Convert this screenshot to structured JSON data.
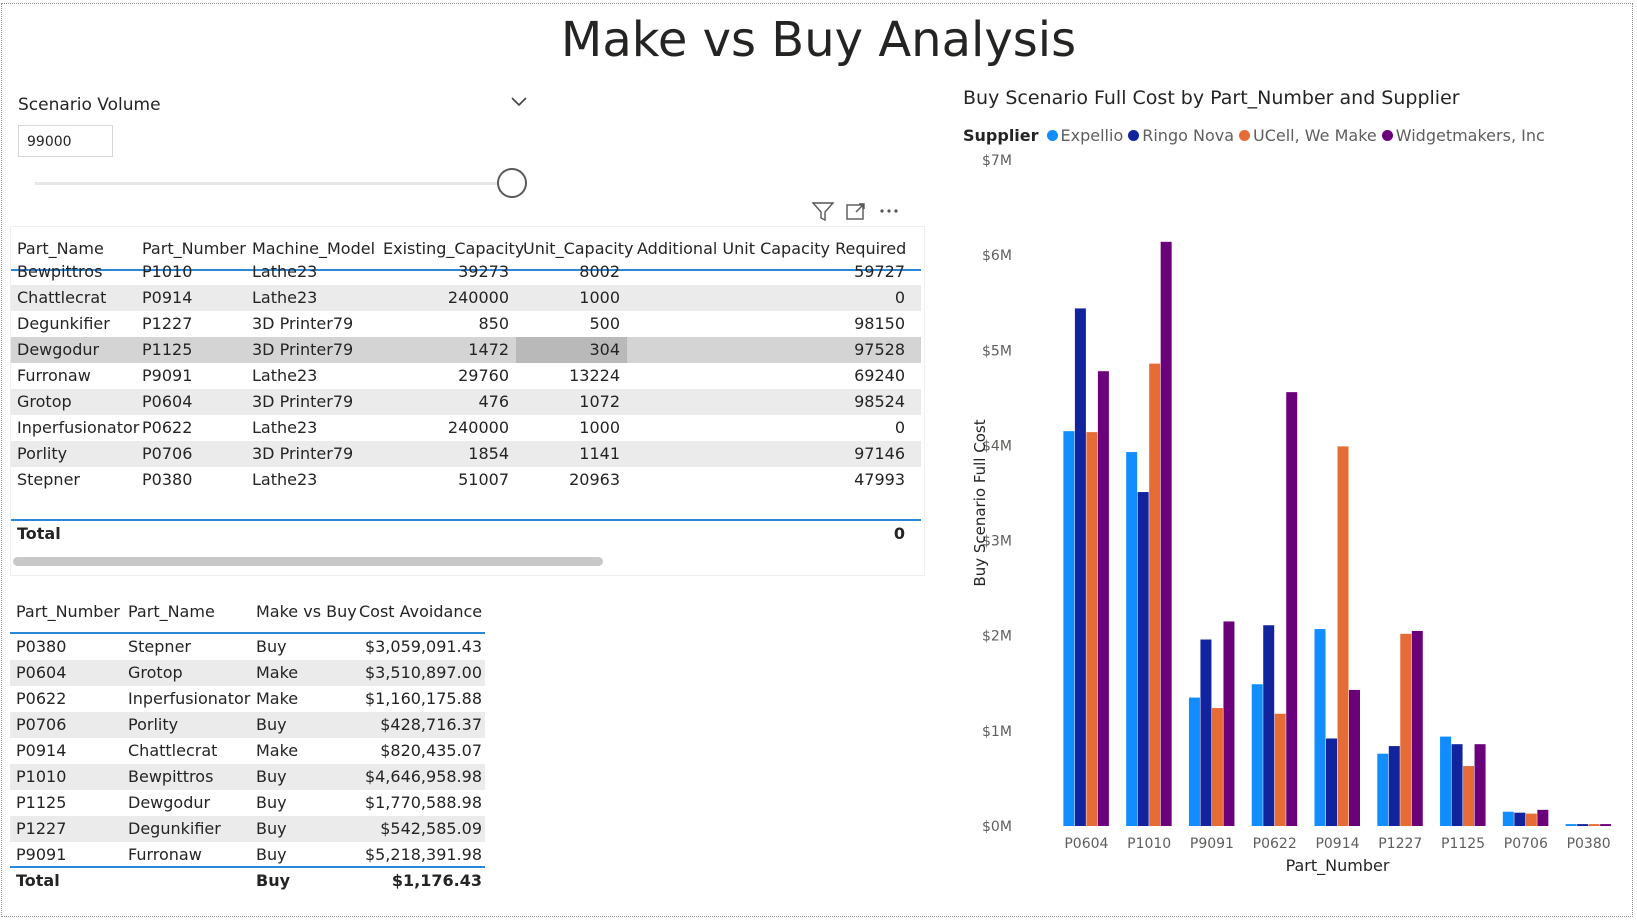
{
  "page": {
    "title": "Make vs Buy Analysis"
  },
  "slicer": {
    "title": "Scenario Volume",
    "value": "99000",
    "icons": {
      "chevron": "chevron-down-icon"
    }
  },
  "visual_header": {
    "icons": [
      "filter-icon",
      "focus-mode-icon",
      "more-options-icon"
    ]
  },
  "capacity_table": {
    "columns": [
      "Part_Name",
      "Part_Number",
      "Machine_Model",
      "Existing_Capacity",
      "Unit_Capacity",
      "Additional Unit Capacity Required"
    ],
    "rows": [
      [
        "Bewpittros",
        "P1010",
        "Lathe23",
        "39273",
        "8002",
        "59727"
      ],
      [
        "Chattlecrat",
        "P0914",
        "Lathe23",
        "240000",
        "1000",
        "0"
      ],
      [
        "Degunkifier",
        "P1227",
        "3D Printer79",
        "850",
        "500",
        "98150"
      ],
      [
        "Dewgodur",
        "P1125",
        "3D Printer79",
        "1472",
        "304",
        "97528"
      ],
      [
        "Furronaw",
        "P9091",
        "Lathe23",
        "29760",
        "13224",
        "69240"
      ],
      [
        "Grotop",
        "P0604",
        "3D Printer79",
        "476",
        "1072",
        "98524"
      ],
      [
        "Inperfusionator",
        "P0622",
        "Lathe23",
        "240000",
        "1000",
        "0"
      ],
      [
        "Porlity",
        "P0706",
        "3D Printer79",
        "1854",
        "1141",
        "97146"
      ],
      [
        "Stepner",
        "P0380",
        "Lathe23",
        "51007",
        "20963",
        "47993"
      ]
    ],
    "total_label": "Total",
    "total_value": "0"
  },
  "decision_table": {
    "columns": [
      "Part_Number",
      "Part_Name",
      "Make vs Buy",
      "Cost Avoidance"
    ],
    "rows": [
      [
        "P0380",
        "Stepner",
        "Buy",
        "$3,059,091.43"
      ],
      [
        "P0604",
        "Grotop",
        "Make",
        "$3,510,897.00"
      ],
      [
        "P0622",
        "Inperfusionator",
        "Make",
        "$1,160,175.88"
      ],
      [
        "P0706",
        "Porlity",
        "Buy",
        "$428,716.37"
      ],
      [
        "P0914",
        "Chattlecrat",
        "Make",
        "$820,435.07"
      ],
      [
        "P1010",
        "Bewpittros",
        "Buy",
        "$4,646,958.98"
      ],
      [
        "P1125",
        "Dewgodur",
        "Buy",
        "$1,770,588.98"
      ],
      [
        "P1227",
        "Degunkifier",
        "Buy",
        "$542,585.09"
      ],
      [
        "P9091",
        "Furronaw",
        "Buy",
        "$5,218,391.98"
      ]
    ],
    "total": [
      "Total",
      "",
      "Buy",
      "$1,176.43"
    ]
  },
  "chart_data": {
    "type": "bar",
    "title": "Buy Scenario Full Cost by Part_Number and Supplier",
    "legend_title": "Supplier",
    "legend_position": "top-left",
    "xlabel": "Part_Number",
    "ylabel": "Buy Scenario Full Cost",
    "ylim": [
      0,
      7000000
    ],
    "yticks": [
      0,
      1000000,
      2000000,
      3000000,
      4000000,
      5000000,
      6000000,
      7000000
    ],
    "ytick_labels": [
      "$0M",
      "$1M",
      "$2M",
      "$3M",
      "$4M",
      "$5M",
      "$6M",
      "$7M"
    ],
    "grid": false,
    "categories": [
      "P0604",
      "P1010",
      "P9091",
      "P0622",
      "P0914",
      "P1227",
      "P1125",
      "P0706",
      "P0380"
    ],
    "series": [
      {
        "name": "Expellio",
        "color": "#118dff",
        "values": [
          4150000,
          3930000,
          1350000,
          1490000,
          2070000,
          760000,
          940000,
          150000,
          20000
        ]
      },
      {
        "name": "Ringo Nova",
        "color": "#12239e",
        "values": [
          5440000,
          3510000,
          1960000,
          2110000,
          920000,
          840000,
          860000,
          140000,
          20000
        ]
      },
      {
        "name": "UCell, We Make",
        "color": "#e66c37",
        "values": [
          4140000,
          4860000,
          1240000,
          1180000,
          3990000,
          2020000,
          630000,
          130000,
          20000
        ]
      },
      {
        "name": "Widgetmakers, Inc",
        "color": "#6b007b",
        "values": [
          4780000,
          6140000,
          2150000,
          4560000,
          1430000,
          2050000,
          860000,
          170000,
          20000
        ]
      }
    ]
  }
}
